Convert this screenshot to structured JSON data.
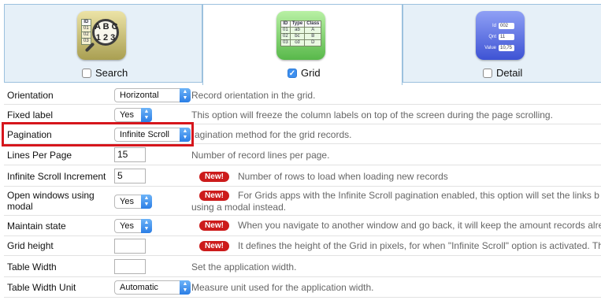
{
  "tabs": [
    {
      "id": "search",
      "label": "Search",
      "checked": false
    },
    {
      "id": "grid",
      "label": "Grid",
      "checked": true
    },
    {
      "id": "detail",
      "label": "Detail",
      "checked": false
    }
  ],
  "search_icon": {
    "letters": "A B C\n1 2 3",
    "cells": [
      [
        "ID"
      ],
      [
        "01"
      ],
      [
        "02"
      ],
      [
        "03"
      ]
    ]
  },
  "grid_icon": {
    "headers": [
      "ID",
      "Type",
      "Class"
    ],
    "rows": [
      [
        "01",
        "ab",
        "A"
      ],
      [
        "02",
        "bc",
        "B"
      ],
      [
        "03",
        "cd",
        "D"
      ]
    ]
  },
  "detail_icon": {
    "rows": [
      [
        "Id",
        "002"
      ],
      [
        "Qnt",
        "11"
      ],
      [
        "Value",
        "10,75"
      ]
    ]
  },
  "settings": [
    {
      "label": "Orientation",
      "control": "select",
      "value": "Horizontal",
      "desc": "Record orientation in the grid.",
      "new": false
    },
    {
      "label": "Fixed label",
      "control": "select",
      "value": "Yes",
      "desc": "This option will freeze the column labels on top of the screen during the page scrolling.",
      "new": false
    },
    {
      "label": "Pagination",
      "control": "select",
      "value": "Infinite Scroll",
      "desc": "agination method for the grid records.",
      "new": false
    },
    {
      "label": "Lines Per Page",
      "control": "input",
      "value": "15",
      "desc": "Number of record lines per page.",
      "new": false
    },
    {
      "label": "Infinite Scroll Increment",
      "control": "input",
      "value": "5",
      "desc": "Number of rows to load when loading new records",
      "new": true
    },
    {
      "label": "Open windows using modal",
      "label2": "modal",
      "label1": "Open windows using",
      "control": "select",
      "value": "Yes",
      "desc": "For Grids apps with the Infinite Scroll pagination enabled, this option will set the links b",
      "desc2": "using a modal instead.",
      "new": true
    },
    {
      "label": "Maintain state",
      "control": "select",
      "value": "Yes",
      "desc": "When you navigate to another window and go back, it will keep the amount records alre",
      "new": true
    },
    {
      "label": "Grid height",
      "control": "input",
      "value": "",
      "desc": "It defines the height of the Grid in pixels, for when \"Infinite Scroll\" option is activated. Th",
      "new": true
    },
    {
      "label": "Table Width",
      "control": "input",
      "value": "",
      "desc": "Set the application width.",
      "new": false
    },
    {
      "label": "Table Width Unit",
      "control": "select",
      "value": "Automatic",
      "desc": "Measure unit used for the application width.",
      "new": false
    }
  ],
  "new_badge_label": "New!",
  "colors": {
    "highlight": "#d6161c",
    "badge": "#cc1b1b",
    "tab_border": "#9cc1de",
    "tab_bg": "#e6f0f8"
  }
}
